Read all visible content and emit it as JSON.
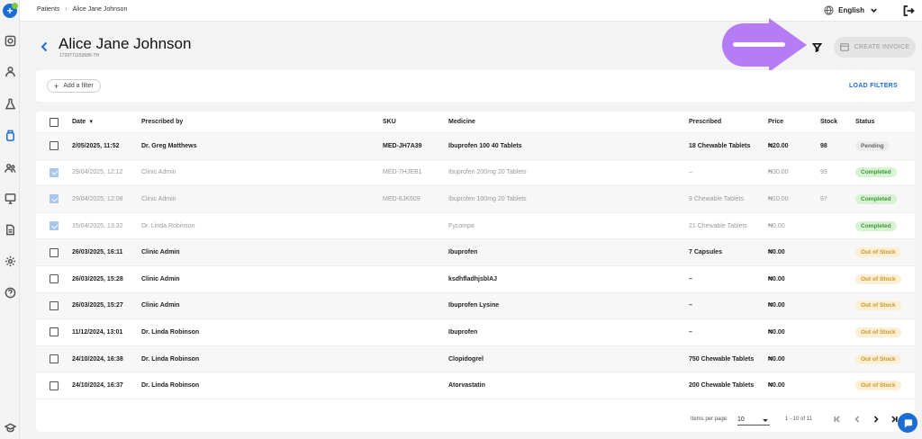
{
  "breadcrumb": {
    "root": "Patients",
    "separator": "›",
    "current": "Alice Jane Johnson"
  },
  "header": {
    "language": "English",
    "patient_name": "Alice Jane Johnson",
    "patient_id": "1729771153686-TH",
    "create_invoice": "CREATE INVOICE"
  },
  "filters": {
    "add_filter": "Add a filter",
    "load_filters": "LOAD FILTERS"
  },
  "table": {
    "columns": [
      "Date",
      "Prescribed by",
      "SKU",
      "Medicine",
      "Prescribed",
      "Price",
      "Stock",
      "Status"
    ],
    "rows": [
      {
        "date": "2/05/2025, 11:52",
        "by": "Dr. Greg Matthews",
        "sku": "MED-JH7A39",
        "medicine": "Ibuprofen 100 40 Tablets",
        "prescribed": "18 Chewable Tablets",
        "price": "₦20.00",
        "stock": "98",
        "status": "Pending",
        "status_kind": "pending",
        "checked": false,
        "style": "dark"
      },
      {
        "date": "29/04/2025, 12:12",
        "by": "Clinic Admin",
        "sku": "MED-7HJEB1",
        "medicine": "Ibuprofen 200mg 20 Tablets",
        "prescribed": "–",
        "price": "₦30.00",
        "stock": "99",
        "status": "Completed",
        "status_kind": "completed",
        "checked": true,
        "style": "dim"
      },
      {
        "date": "29/04/2025, 12:08",
        "by": "Clinic Admin",
        "sku": "MED-6JK609",
        "medicine": "Ibuprofen 100mg 20 Tablets",
        "prescribed": "9 Chewable Tablets",
        "price": "₦10.00",
        "stock": "97",
        "status": "Completed",
        "status_kind": "completed",
        "checked": true,
        "style": "dim"
      },
      {
        "date": "15/04/2025, 13:32",
        "by": "Dr. Linda Robinson",
        "sku": "",
        "medicine": "Fycompa",
        "prescribed": "21 Chewable Tablets",
        "price": "₦0.00",
        "stock": "",
        "status": "Completed",
        "status_kind": "completed",
        "checked": true,
        "style": "dim"
      },
      {
        "date": "26/03/2025, 16:11",
        "by": "Clinic Admin",
        "sku": "",
        "medicine": "Ibuprofen",
        "prescribed": "7 Capsules",
        "price": "₦0.00",
        "stock": "",
        "status": "Out of Stock",
        "status_kind": "oos",
        "checked": false,
        "style": "dark"
      },
      {
        "date": "26/03/2025, 15:28",
        "by": "Clinic Admin",
        "sku": "",
        "medicine": "ksdhfladhjsblAJ",
        "prescribed": "–",
        "price": "₦0.00",
        "stock": "",
        "status": "Out of Stock",
        "status_kind": "oos",
        "checked": false,
        "style": "dark"
      },
      {
        "date": "26/03/2025, 15:27",
        "by": "Clinic Admin",
        "sku": "",
        "medicine": "Ibuprofen Lysine",
        "prescribed": "–",
        "price": "₦0.00",
        "stock": "",
        "status": "Out of Stock",
        "status_kind": "oos",
        "checked": false,
        "style": "dark"
      },
      {
        "date": "11/12/2024, 13:01",
        "by": "Dr. Linda Robinson",
        "sku": "",
        "medicine": "Ibuprofen",
        "prescribed": "–",
        "price": "₦0.00",
        "stock": "",
        "status": "Out of Stock",
        "status_kind": "oos",
        "checked": false,
        "style": "dark"
      },
      {
        "date": "24/10/2024, 16:38",
        "by": "Dr. Linda Robinson",
        "sku": "",
        "medicine": "Clopidogrel",
        "prescribed": "750 Chewable Tablets",
        "price": "₦0.00",
        "stock": "",
        "status": "Out of Stock",
        "status_kind": "oos",
        "checked": false,
        "style": "dark"
      },
      {
        "date": "24/10/2024, 16:37",
        "by": "Dr. Linda Robinson",
        "sku": "",
        "medicine": "Atorvastatin",
        "prescribed": "200 Chewable Tablets",
        "price": "₦0.00",
        "stock": "",
        "status": "Out of Stock",
        "status_kind": "oos",
        "checked": false,
        "style": "dark"
      }
    ]
  },
  "pagination": {
    "items_per_page_label": "Items per page:",
    "items_per_page": "10",
    "range": "1 - 10 of 11"
  },
  "colors": {
    "accent": "#1b6dd6",
    "pointer": "#b57cf6",
    "completed_bg": "#d8f2d4",
    "oos_bg": "#fcefd3"
  }
}
